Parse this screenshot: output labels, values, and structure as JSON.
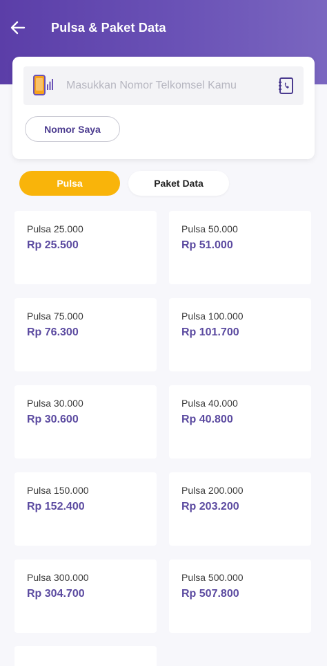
{
  "header": {
    "title": "Pulsa & Paket Data",
    "back_icon": "arrow-left-icon",
    "colors": {
      "start": "#5b3ea8",
      "end": "#7a66c0"
    }
  },
  "phone_input": {
    "placeholder": "Masukkan Nomor Telkomsel Kamu",
    "value": "",
    "leading_icon": "phone-signal-icon",
    "trailing_icon": "contact-book-icon"
  },
  "my_number_button": {
    "label": "Nomor Saya"
  },
  "tabs": [
    {
      "label": "Pulsa",
      "active": true,
      "color": "#f9b40a"
    },
    {
      "label": "Paket Data",
      "active": false
    }
  ],
  "products": [
    {
      "name": "Pulsa 25.000",
      "price": "Rp 25.500"
    },
    {
      "name": "Pulsa 50.000",
      "price": "Rp 51.000"
    },
    {
      "name": "Pulsa 75.000",
      "price": "Rp 76.300"
    },
    {
      "name": "Pulsa 100.000",
      "price": "Rp 101.700"
    },
    {
      "name": "Pulsa 30.000",
      "price": "Rp 30.600"
    },
    {
      "name": "Pulsa 40.000",
      "price": "Rp 40.800"
    },
    {
      "name": "Pulsa 150.000",
      "price": "Rp 152.400"
    },
    {
      "name": "Pulsa 200.000",
      "price": "Rp 203.200"
    },
    {
      "name": "Pulsa 300.000",
      "price": "Rp 304.700"
    },
    {
      "name": "Pulsa 500.000",
      "price": "Rp 507.800"
    }
  ],
  "price_color": "#5b4aa0"
}
